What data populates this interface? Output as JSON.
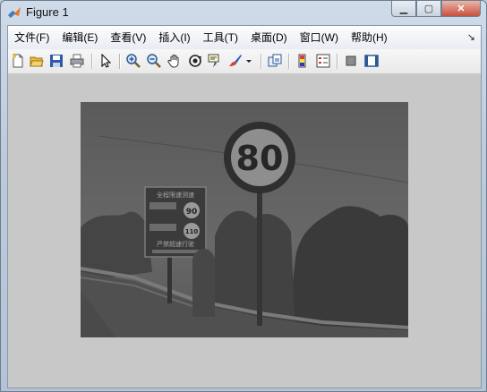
{
  "window": {
    "title": "Figure 1",
    "controls": [
      "minimize",
      "maximize",
      "close"
    ]
  },
  "menubar": {
    "items": [
      "文件(F)",
      "编辑(E)",
      "查看(V)",
      "插入(I)",
      "工具(T)",
      "桌面(D)",
      "窗口(W)",
      "帮助(H)"
    ]
  },
  "toolbar": {
    "icons": [
      "new-figure-icon",
      "open-file-icon",
      "save-icon",
      "print-icon",
      "edit-plot-arrow-icon",
      "zoom-in-icon",
      "zoom-out-icon",
      "pan-hand-icon",
      "rotate-3d-icon",
      "data-cursor-icon",
      "brush-icon",
      "brush-dropdown-icon",
      "link-plot-icon",
      "colorbar-icon",
      "legend-icon",
      "hide-plot-tools-icon",
      "show-plot-tools-icon"
    ]
  },
  "image": {
    "description_colors": {
      "sky": "#636363",
      "sign_border": "#2e2e2e",
      "sign_face": "#8e8e8e"
    },
    "speed_sign_text": "80",
    "board_text_top": "全程限速测速",
    "board_value_1": "90",
    "board_value_2": "110",
    "board_text_bottom": "严禁超速行驶"
  },
  "colors": {
    "canvas_bg": "#c8c8c8",
    "menubar_bg": "#f5f6f9",
    "close_button": "#c7503c"
  }
}
